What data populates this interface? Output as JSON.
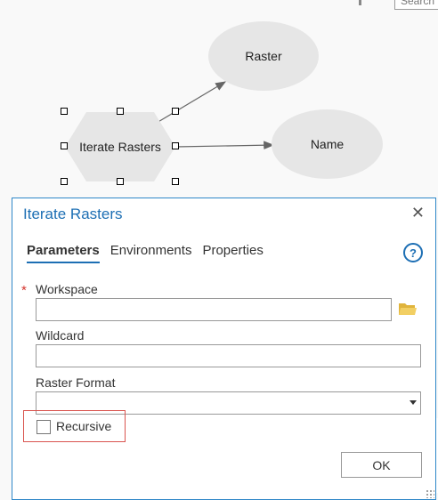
{
  "canvas": {
    "search_placeholder": "Search",
    "nodes": {
      "raster": "Raster",
      "name": "Name",
      "iterate": "Iterate Rasters"
    }
  },
  "dialog": {
    "title": "Iterate Rasters",
    "tabs": [
      "Parameters",
      "Environments",
      "Properties"
    ],
    "active_tab": "Parameters",
    "fields": {
      "workspace_label": "Workspace",
      "workspace_value": "",
      "wildcard_label": "Wildcard",
      "wildcard_value": "",
      "raster_format_label": "Raster Format",
      "raster_format_value": ""
    },
    "recursive_label": "Recursive",
    "recursive_checked": false,
    "ok_label": "OK",
    "colors": {
      "accent": "#1d6fb4",
      "required": "#d4362e",
      "highlight": "#d9544f",
      "node_fill": "#e6e6e6"
    }
  }
}
